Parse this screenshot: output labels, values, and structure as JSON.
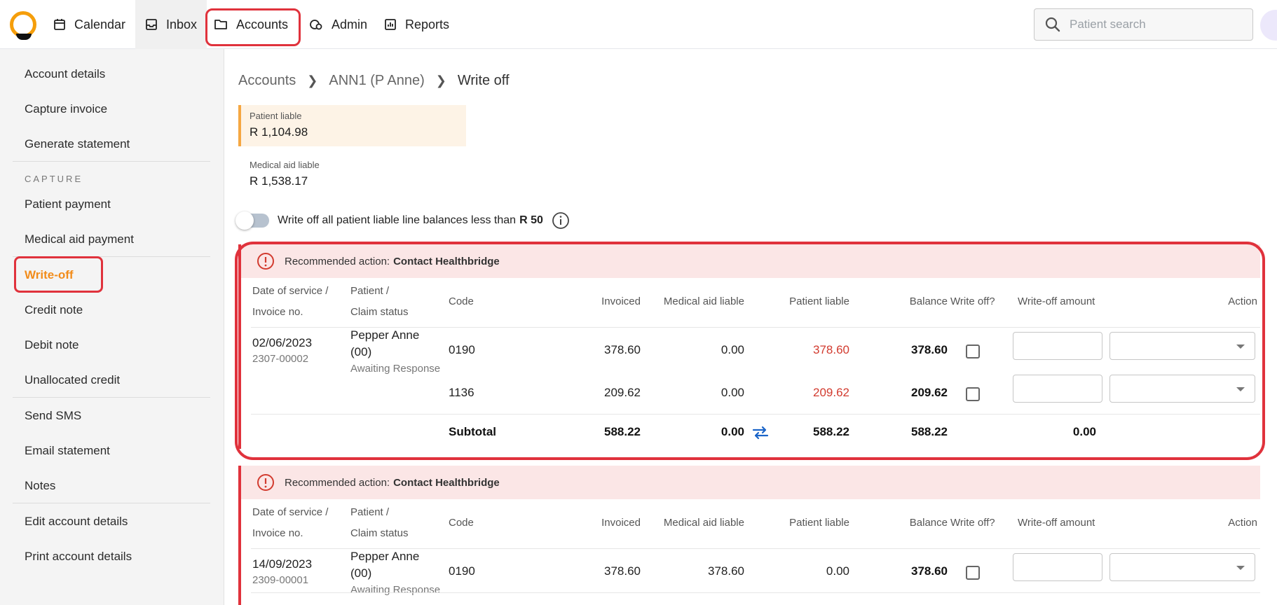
{
  "nav": {
    "items": [
      {
        "label": "Calendar"
      },
      {
        "label": "Inbox"
      },
      {
        "label": "Accounts"
      },
      {
        "label": "Admin"
      },
      {
        "label": "Reports"
      }
    ],
    "search_placeholder": "Patient search"
  },
  "sidebar": {
    "items": [
      {
        "label": "Account details"
      },
      {
        "label": "Capture invoice"
      },
      {
        "label": "Generate statement"
      },
      {
        "label": "Patient payment"
      },
      {
        "label": "Medical aid payment"
      },
      {
        "label": "Write-off"
      },
      {
        "label": "Credit note"
      },
      {
        "label": "Debit note"
      },
      {
        "label": "Unallocated credit"
      },
      {
        "label": "Send SMS"
      },
      {
        "label": "Email statement"
      },
      {
        "label": "Notes"
      },
      {
        "label": "Edit account details"
      },
      {
        "label": "Print account details"
      }
    ],
    "section_capture": "CAPTURE"
  },
  "breadcrumb": [
    "Accounts",
    "ANN1 (P Anne)",
    "Write off"
  ],
  "summary": {
    "patient_liable_label": "Patient liable",
    "patient_liable_value": "R 1,104.98",
    "medical_aid_label": "Medical aid liable",
    "medical_aid_value": "R 1,538.17"
  },
  "toggle": {
    "label": "Write off all patient liable line balances less than",
    "amount": "R 50"
  },
  "table_headers": {
    "date1": "Date of service /",
    "date2": "Invoice no.",
    "patient1": "Patient /",
    "patient2": "Claim status",
    "code": "Code",
    "invoiced": "Invoiced",
    "medical": "Medical aid liable",
    "patient_liable": "Patient liable",
    "balance": "Balance",
    "writeoff": "Write off?",
    "amount": "Write-off amount",
    "action": "Action"
  },
  "claims": [
    {
      "alert_prefix": "Recommended action:",
      "alert_action": "Contact Healthbridge",
      "date": "02/06/2023",
      "invoice": "2307-00002",
      "patient_line1": "Pepper Anne",
      "patient_line2": "(00)",
      "status": "Awaiting Response",
      "lines": [
        {
          "code": "0190",
          "invoiced": "378.60",
          "medical": "0.00",
          "patient": "378.60",
          "balance": "378.60"
        },
        {
          "code": "1136",
          "invoiced": "209.62",
          "medical": "0.00",
          "patient": "209.62",
          "balance": "209.62"
        }
      ],
      "subtotal": {
        "label": "Subtotal",
        "invoiced": "588.22",
        "medical": "0.00",
        "patient": "588.22",
        "balance": "588.22",
        "writeoff": "0.00"
      }
    },
    {
      "alert_prefix": "Recommended action:",
      "alert_action": "Contact Healthbridge",
      "date": "14/09/2023",
      "invoice": "2309-00001",
      "patient_line1": "Pepper Anne",
      "patient_line2": "(00)",
      "status": "Awaiting Response",
      "lines": [
        {
          "code": "0190",
          "invoiced": "378.60",
          "medical": "378.60",
          "patient": "0.00",
          "balance": "378.60"
        }
      ]
    }
  ],
  "colors": {
    "accent_orange": "#f28c1a",
    "alert_red": "#e0323c",
    "alert_bg": "#fbe6e6",
    "patient_liable_bg": "#fdf3e6"
  }
}
